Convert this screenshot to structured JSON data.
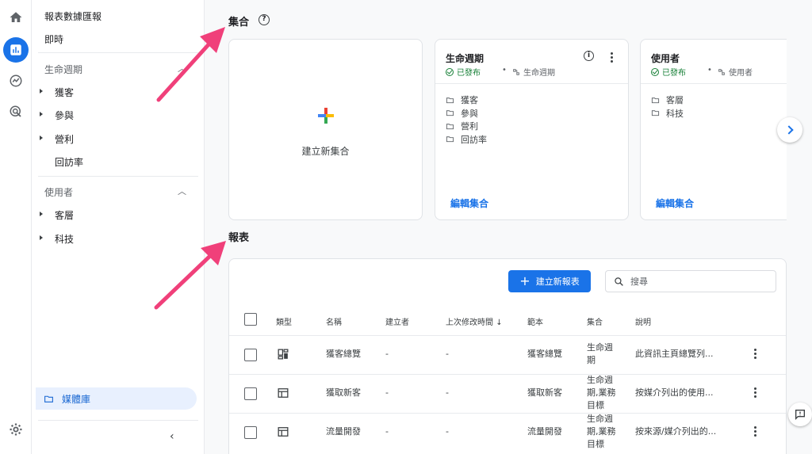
{
  "sidebar": {
    "top_items": [
      "報表數據匯報",
      "即時"
    ],
    "sections": [
      {
        "title": "生命週期",
        "items": [
          "獲客",
          "參與",
          "營利",
          "回訪率"
        ]
      },
      {
        "title": "使用者",
        "items": [
          "客層",
          "科技"
        ]
      }
    ],
    "library": "媒體庫"
  },
  "collections": {
    "title": "集合",
    "create_label": "建立新集合",
    "cards": [
      {
        "title": "生命週期",
        "status": "已發布",
        "template": "生命週期",
        "items": [
          "獲客",
          "參與",
          "營利",
          "回訪率"
        ],
        "edit": "編輯集合"
      },
      {
        "title": "使用者",
        "status": "已發布",
        "template": "使用者",
        "items": [
          "客層",
          "科技"
        ],
        "edit": "編輯集合"
      }
    ]
  },
  "reports": {
    "title": "報表",
    "new_button": "建立新報表",
    "search_placeholder": "搜尋",
    "columns": [
      "類型",
      "名稱",
      "建立者",
      "上次修改時間",
      "範本",
      "集合",
      "說明"
    ],
    "rows": [
      {
        "type_icon": "overview-icon",
        "name": "獲客總覽",
        "creator": "-",
        "modified": "-",
        "template": "獲客總覽",
        "collection": "生命週\n期",
        "desc": "此資訊主頁總覽列..."
      },
      {
        "type_icon": "table-icon",
        "name": "獲取新客",
        "creator": "-",
        "modified": "-",
        "template": "獲取新客",
        "collection": "生命週\n期,業務\n目標",
        "desc": "按媒介列出的使用..."
      },
      {
        "type_icon": "table-icon",
        "name": "流量開發",
        "creator": "-",
        "modified": "-",
        "template": "流量開發",
        "collection": "生命週\n期,業務\n目標",
        "desc": "按來源/媒介列出的..."
      }
    ]
  },
  "colors": {
    "accent": "#1a73e8",
    "arrow": "#f0407a",
    "published": "#188038"
  }
}
